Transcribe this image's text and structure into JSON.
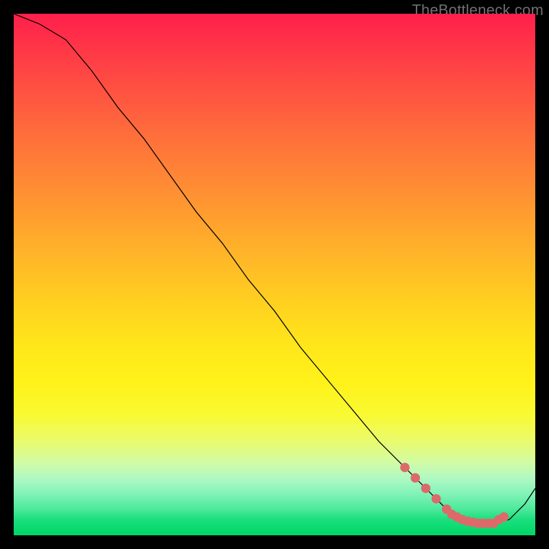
{
  "watermark": "TheBottleneck.com",
  "chart_data": {
    "type": "line",
    "title": "",
    "xlabel": "",
    "ylabel": "",
    "xlim": [
      0,
      100
    ],
    "ylim": [
      0,
      100
    ],
    "series": [
      {
        "name": "bottleneck-curve",
        "x": [
          0,
          5,
          10,
          15,
          20,
          25,
          30,
          35,
          40,
          45,
          50,
          55,
          60,
          65,
          70,
          75,
          80,
          83,
          86,
          89,
          92,
          95,
          98,
          100
        ],
        "values": [
          100,
          98,
          95,
          89,
          82,
          76,
          69,
          62,
          56,
          49,
          43,
          36,
          30,
          24,
          18,
          13,
          8,
          5,
          3,
          2.3,
          2.3,
          3,
          6,
          9
        ]
      }
    ],
    "highlight_points": {
      "name": "highlight-zone",
      "x": [
        75,
        77,
        79,
        81,
        83,
        84,
        85,
        86,
        87,
        88,
        89,
        90,
        91,
        92,
        93,
        94
      ],
      "values": [
        13,
        11,
        9,
        7,
        5,
        4,
        3.5,
        3,
        2.7,
        2.5,
        2.3,
        2.3,
        2.3,
        2.3,
        3,
        3.5
      ]
    },
    "colors": {
      "curve": "#000000",
      "highlight": "#dd6a6a",
      "gradient_top": "#ff1f4b",
      "gradient_bottom": "#00d766"
    }
  }
}
